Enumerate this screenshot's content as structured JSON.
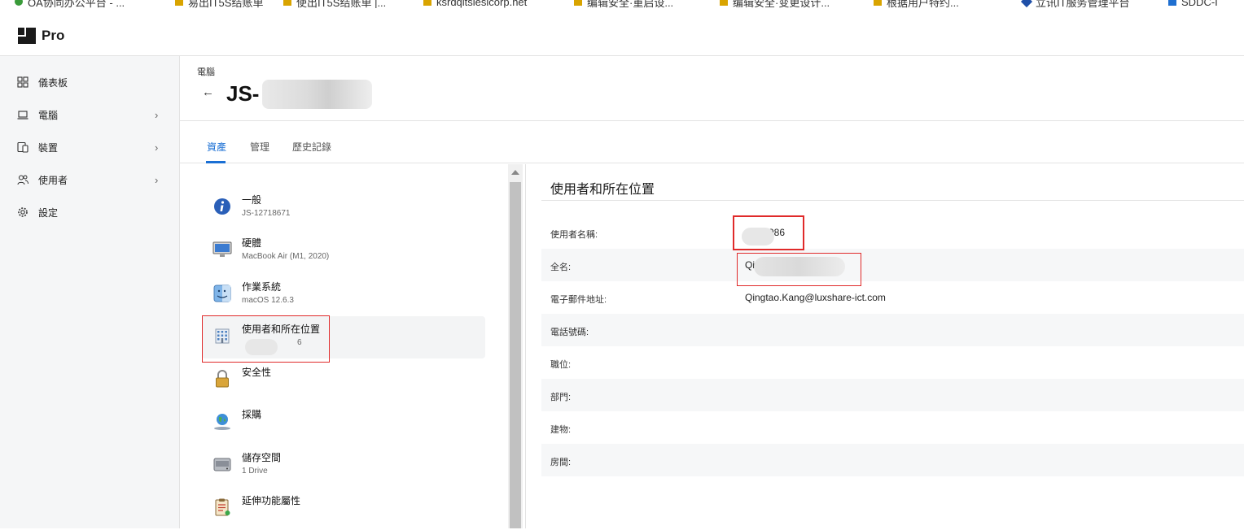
{
  "bookmarks": [
    {
      "label": "OA协同办公平台 - ...",
      "color": "#3a9b3a"
    },
    {
      "label": "易出IT5S结账单",
      "color": "#d9a400"
    },
    {
      "label": "使出IT5S结账单 |...",
      "color": "#d9a400"
    },
    {
      "label": "ksrdqitsiesicorp.net",
      "color": "#d9a400"
    },
    {
      "label": "编辑安全·重启设...",
      "color": "#d9a400"
    },
    {
      "label": "编辑安全·变更设计...",
      "color": "#d9a400"
    },
    {
      "label": "根据用户特约...",
      "color": "#d9a400"
    },
    {
      "label": "立讯IT服务管理平台",
      "color": "#1f4fa8"
    },
    {
      "label": "SDDC-I",
      "color": "#1f6fd0"
    }
  ],
  "app": {
    "brand": "Pro"
  },
  "sidebar": {
    "items": [
      {
        "label": "儀表板",
        "icon": "dashboard-icon",
        "chevron": ""
      },
      {
        "label": "電腦",
        "icon": "laptop-icon",
        "chevron": "›"
      },
      {
        "label": "裝置",
        "icon": "devices-icon",
        "chevron": "›"
      },
      {
        "label": "使用者",
        "icon": "users-icon",
        "chevron": "›"
      },
      {
        "label": "設定",
        "icon": "gear-icon",
        "chevron": ""
      }
    ]
  },
  "header": {
    "breadcrumb": "電腦",
    "back_icon": "←",
    "title": "JS-"
  },
  "tabs": [
    {
      "label": "資產",
      "active": true
    },
    {
      "label": "管理",
      "active": false
    },
    {
      "label": "歷史記錄",
      "active": false
    }
  ],
  "categories": [
    {
      "title": "一般",
      "subtitle": "JS-12718671",
      "icon": "info-icon"
    },
    {
      "title": "硬體",
      "subtitle": "MacBook Air (M1, 2020)",
      "icon": "monitor-icon"
    },
    {
      "title": "作業系統",
      "subtitle": "macOS 12.6.3",
      "icon": "finder-icon"
    },
    {
      "title": "使用者和所在位置",
      "subtitle": "6",
      "icon": "building-icon",
      "selected": true
    },
    {
      "title": "安全性",
      "subtitle": "",
      "icon": "lock-icon"
    },
    {
      "title": "採購",
      "subtitle": "",
      "icon": "globe-icon"
    },
    {
      "title": "儲存空間",
      "subtitle": "1 Drive",
      "icon": "drive-icon"
    },
    {
      "title": "延伸功能屬性",
      "subtitle": "",
      "icon": "clipboard-icon"
    }
  ],
  "detail": {
    "section_title": "使用者和所在位置",
    "rows": [
      {
        "label": "使用者名稱:",
        "value": "986"
      },
      {
        "label": "全名:",
        "value": "Qin"
      },
      {
        "label": "電子郵件地址:",
        "value": "Qingtao.Kang@luxshare-ict.com"
      },
      {
        "label": "電話號碼:",
        "value": ""
      },
      {
        "label": "職位:",
        "value": ""
      },
      {
        "label": "部門:",
        "value": ""
      },
      {
        "label": "建物:",
        "value": ""
      },
      {
        "label": "房間:",
        "value": ""
      }
    ]
  },
  "colors": {
    "accent": "#1a6fd4",
    "highlight_border": "#e02a2a",
    "sidebar_bg": "#f5f6f7"
  }
}
